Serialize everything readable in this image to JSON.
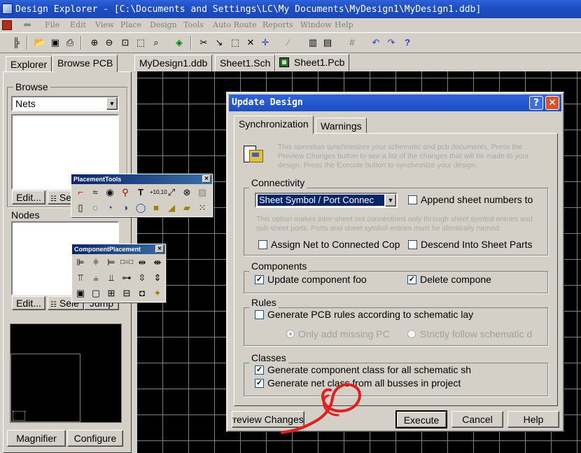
{
  "window": {
    "title": "Design Explorer - [C:\\Documents and Settings\\LC\\My Documents\\MyDesign1\\MyDesign1.ddb]"
  },
  "menu": [
    "File",
    "Edit",
    "View",
    "Place",
    "Design",
    "Tools",
    "Auto Route",
    "Reports",
    "Window",
    "Help"
  ],
  "left_panel": {
    "tabs": [
      "Explorer",
      "Browse PCB"
    ],
    "browse_label": "Browse",
    "browse_select": "Nets",
    "edit_label": "Edit...",
    "select_label": "Se",
    "nodes_label": "Nodes",
    "edit2_label": "Edit...",
    "select2_label": "Sele",
    "jump_label": "Jump",
    "magnifier_label": "Magnifier",
    "configure_label": "Configure"
  },
  "doc_tabs": [
    "MyDesign1.ddb",
    "Sheet1.Sch",
    "Sheet1.Pcb"
  ],
  "placement_tools": {
    "title": "PlacementTools"
  },
  "component_placement": {
    "title": "ComponentPlacement"
  },
  "dialog": {
    "title": "Update Design",
    "tabs": [
      "Synchronization",
      "Warnings"
    ],
    "intro": "This operation synchronizes your schematic and pcb documents.  Press the Preview Changes button to see a list of the changes that will be made to your design.  Press the Execute button to synchronize your design.",
    "connectivity": {
      "label": "Connectivity",
      "select_value": "Sheet Symbol / Port Connec",
      "append": {
        "label": "Append sheet numbers to",
        "checked": false
      },
      "note": "This option makes inter-sheet net connections only through sheet symbol entries and sub-sheet ports. Ports and sheet symbol entries must be identically named.",
      "assign": {
        "label": "Assign Net to Connected Cop",
        "checked": false
      },
      "descend": {
        "label": "Descend Into Sheet Parts",
        "checked": false
      }
    },
    "components": {
      "label": "Components",
      "update": {
        "label": "Update component foo",
        "checked": true
      },
      "delete": {
        "label": "Delete compone",
        "checked": true
      }
    },
    "rules": {
      "label": "Rules",
      "generate": {
        "label": "Generate PCB rules according to schematic lay",
        "checked": false
      },
      "only_missing": "Only add missing PC",
      "strictly": "Strictly follow schematic d"
    },
    "classes": {
      "label": "Classes",
      "component_class": {
        "label": "Generate component class for all schematic sh",
        "checked": true
      },
      "net_class": {
        "label": "Generate net class from all busses in project",
        "checked": true
      }
    },
    "buttons": {
      "preview": "Preview Changes",
      "execute": "Execute",
      "cancel": "Cancel",
      "help": "Help"
    }
  },
  "colors": {
    "titlebar": "#1d4ec4",
    "canvas": "#000000",
    "grid": "#808080",
    "annotation": "#e02020"
  }
}
